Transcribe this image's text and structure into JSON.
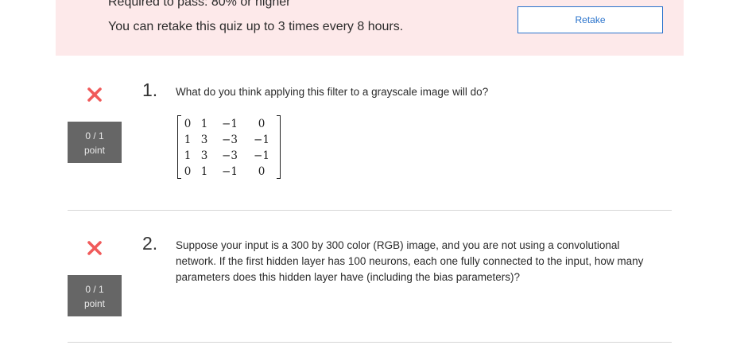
{
  "banner": {
    "required_text": "Required to pass: 80% or higher",
    "retake_info": "You can retake this quiz up to 3 times every 8 hours.",
    "retake_button": "Retake"
  },
  "colors": {
    "banner_bg": "#fde9ea",
    "incorrect_icon": "#f05a5a",
    "score_bg": "#666666",
    "link_blue": "#2a73cc"
  },
  "questions": [
    {
      "number": "1.",
      "status_icon": "close-icon",
      "score": "0 / 1",
      "score_unit": "point",
      "text": "What do you think applying this filter to a grayscale image will do?",
      "matrix": [
        [
          "0",
          "1",
          "−1",
          "0"
        ],
        [
          "1",
          "3",
          "−3",
          "−1"
        ],
        [
          "1",
          "3",
          "−3",
          "−1"
        ],
        [
          "0",
          "1",
          "−1",
          "0"
        ]
      ]
    },
    {
      "number": "2.",
      "status_icon": "close-icon",
      "score": "0 / 1",
      "score_unit": "point",
      "text": "Suppose your input is a 300 by 300 color (RGB) image, and you are not using a convolutional network. If the first hidden layer has 100 neurons, each one fully connected to the input, how many parameters does this hidden layer have (including the bias parameters)?"
    }
  ]
}
